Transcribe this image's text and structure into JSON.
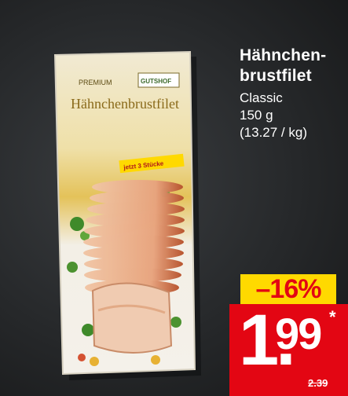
{
  "product": {
    "title_line1": "Hähnchen-",
    "title_line2": "brustfilet",
    "variant": "Classic",
    "weight": "150 g",
    "unit_price": "(13.27 / kg)"
  },
  "packaging": {
    "brand_small": "PREMIUM",
    "brand_logo": "GUTSHOF",
    "product_name": "Hähnchenbrustfilet",
    "sticker": "jetzt 3 Stücke"
  },
  "discount": {
    "label": "–16%"
  },
  "price": {
    "integer": "1.",
    "decimals": "99",
    "star": "*",
    "old_price": "2.39"
  },
  "colors": {
    "background": "#26282a",
    "badge_yellow": "#ffd900",
    "price_red": "#e30613",
    "text_white": "#ffffff"
  }
}
